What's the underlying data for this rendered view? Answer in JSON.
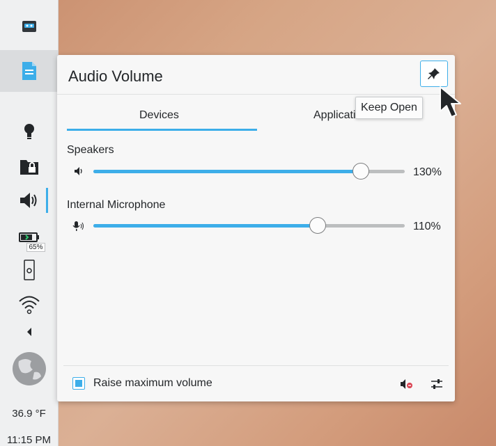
{
  "panel": {
    "battery_label": "65%",
    "temperature": "36.9 °F",
    "clock": "11:15 PM",
    "icons": [
      "tape-icon",
      "document-icon",
      "lightbulb-icon",
      "lock-folder-icon",
      "speaker-icon",
      "battery-icon",
      "phone-connect-icon",
      "wifi-icon",
      "chevron-left-icon",
      "globe-icon"
    ]
  },
  "popup": {
    "title": "Audio Volume",
    "tabs": [
      "Devices",
      "Applications"
    ],
    "active_tab": "Devices",
    "tooltip": "Keep Open",
    "devices": [
      {
        "name": "Speakers",
        "percent_label": "130%",
        "fill_fraction": 0.86
      },
      {
        "name": "Internal Microphone",
        "percent_label": "110%",
        "fill_fraction": 0.72
      }
    ],
    "footer": {
      "checkbox_label": "Raise maximum volume",
      "checkbox_checked": true
    }
  },
  "colors": {
    "accent": "#3daee9",
    "text": "#232629",
    "track": "#bcbebf"
  }
}
